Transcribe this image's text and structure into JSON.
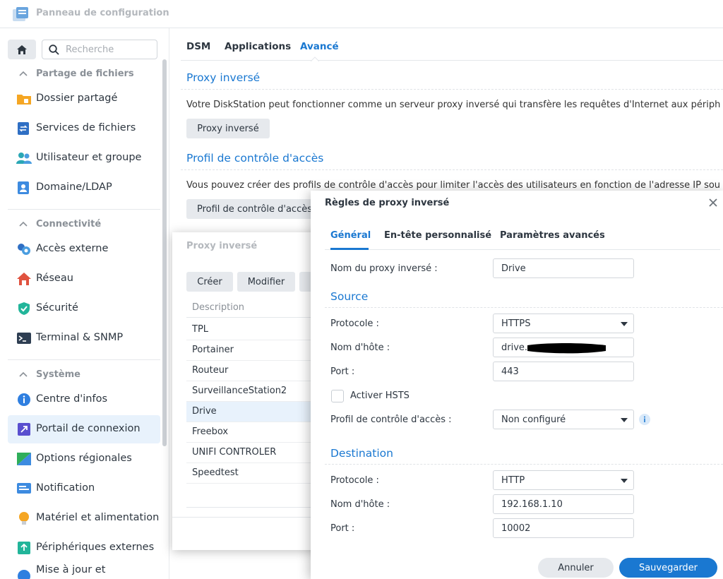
{
  "window": {
    "title": "Panneau de configuration"
  },
  "sidebar": {
    "search_placeholder": "Recherche",
    "sections": [
      {
        "label": "Partage de fichiers",
        "items": [
          {
            "label": "Dossier partagé",
            "icon": "folder-icon"
          },
          {
            "label": "Services de fichiers",
            "icon": "file-services-icon"
          },
          {
            "label": "Utilisateur et groupe",
            "icon": "users-icon"
          },
          {
            "label": "Domaine/LDAP",
            "icon": "ldap-icon"
          }
        ]
      },
      {
        "label": "Connectivité",
        "items": [
          {
            "label": "Accès externe",
            "icon": "external-access-icon"
          },
          {
            "label": "Réseau",
            "icon": "network-icon"
          },
          {
            "label": "Sécurité",
            "icon": "security-icon"
          },
          {
            "label": "Terminal & SNMP",
            "icon": "terminal-icon"
          }
        ]
      },
      {
        "label": "Système",
        "items": [
          {
            "label": "Centre d'infos",
            "icon": "info-center-icon"
          },
          {
            "label": "Portail de connexion",
            "icon": "login-portal-icon",
            "active": true
          },
          {
            "label": "Options régionales",
            "icon": "regional-icon"
          },
          {
            "label": "Notification",
            "icon": "notification-icon"
          },
          {
            "label": "Matériel et alimentation",
            "icon": "hardware-power-icon"
          },
          {
            "label": "Périphériques externes",
            "icon": "external-devices-icon"
          },
          {
            "label": "Mise à jour et",
            "icon": "update-icon"
          }
        ]
      }
    ]
  },
  "main": {
    "tabs": [
      "DSM",
      "Applications",
      "Avancé"
    ],
    "active_tab": "Avancé",
    "proxy_section": {
      "title": "Proxy inversé",
      "description": "Votre DiskStation peut fonctionner comme un serveur proxy inversé qui transfère les requêtes d'Internet aux périph",
      "button": "Proxy inversé"
    },
    "acl_section": {
      "title": "Profil de contrôle d'accès",
      "description": "Vous pouvez créer des profils de contrôle d'accès pour limiter l'accès des utilisateurs en fonction de l'adresse IP sou",
      "button": "Profil de contrôle d'accès"
    }
  },
  "proxy_dialog": {
    "title": "Proxy inversé",
    "buttons": {
      "create": "Créer",
      "edit": "Modifier"
    },
    "column": "Description",
    "rows": [
      "TPL",
      "Portainer",
      "Routeur",
      "SurveillanceStation2",
      "Drive",
      "Freebox",
      "UNIFI CONTROLER",
      "Speedtest"
    ],
    "selected_row": "Drive"
  },
  "rules_dialog": {
    "title": "Règles de proxy inversé",
    "tabs": [
      "Général",
      "En-tête personnalisé",
      "Paramètres avancés"
    ],
    "active_tab": "Général",
    "name_label": "Nom du proxy inversé :",
    "name_value": "Drive",
    "source": {
      "title": "Source",
      "protocol_label": "Protocole :",
      "protocol_value": "HTTPS",
      "host_label": "Nom d'hôte :",
      "host_value": "drive.",
      "port_label": "Port :",
      "port_value": "443",
      "hsts_label": "Activer HSTS",
      "hsts_checked": false,
      "acl_label": "Profil de contrôle d'accès :",
      "acl_value": "Non configuré"
    },
    "destination": {
      "title": "Destination",
      "protocol_label": "Protocole :",
      "protocol_value": "HTTP",
      "host_label": "Nom d'hôte :",
      "host_value": "192.168.1.10",
      "port_label": "Port :",
      "port_value": "10002"
    },
    "buttons": {
      "cancel": "Annuler",
      "save": "Sauvegarder"
    }
  },
  "colors": {
    "accent": "#1a78d1",
    "active_bg": "#e8f2fc",
    "button_bg": "#e6e9ed"
  }
}
